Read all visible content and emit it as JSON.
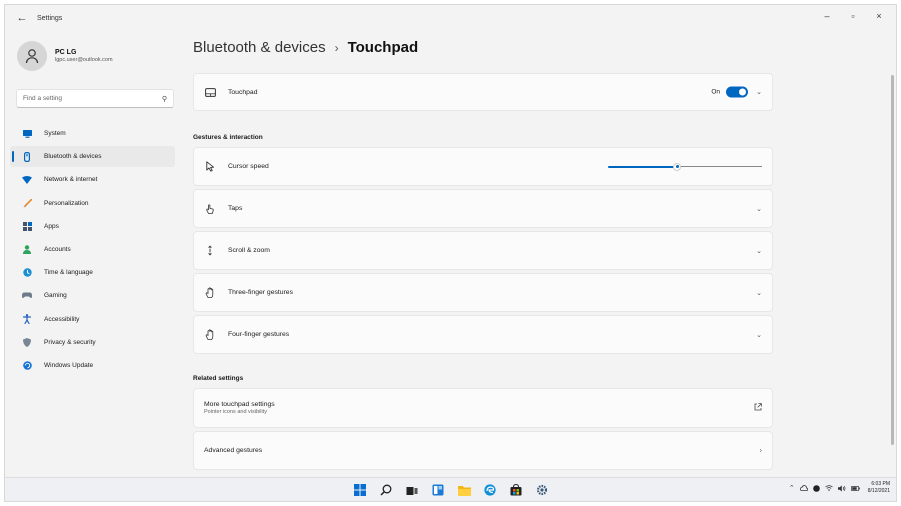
{
  "window": {
    "app_title": "Settings",
    "back_glyph": "←",
    "controls": {
      "minimize": "–",
      "maximize": "▫",
      "close": "×"
    }
  },
  "profile": {
    "name": "PC LG",
    "email": "lgpc.user@outlook.com"
  },
  "search": {
    "placeholder": "Find a setting",
    "icon": "search-icon"
  },
  "sidebar": {
    "items": [
      {
        "label": "System",
        "icon": "system-icon",
        "color": "#0067c0",
        "active": false
      },
      {
        "label": "Bluetooth & devices",
        "icon": "bluetooth-icon",
        "color": "#0067c0",
        "active": true
      },
      {
        "label": "Network & internet",
        "icon": "network-icon",
        "color": "#0067c0",
        "active": false
      },
      {
        "label": "Personalization",
        "icon": "personalization-icon",
        "color": "#e58a2e",
        "active": false
      },
      {
        "label": "Apps",
        "icon": "apps-icon",
        "color": "#44546a",
        "active": false
      },
      {
        "label": "Accounts",
        "icon": "accounts-icon",
        "color": "#2fa35c",
        "active": false
      },
      {
        "label": "Time & language",
        "icon": "time-language-icon",
        "color": "#1b8fd1",
        "active": false
      },
      {
        "label": "Gaming",
        "icon": "gaming-icon",
        "color": "#6c7a89",
        "active": false
      },
      {
        "label": "Accessibility",
        "icon": "accessibility-icon",
        "color": "#1f5fbf",
        "active": false
      },
      {
        "label": "Privacy & security",
        "icon": "shield-icon",
        "color": "#7a8694",
        "active": false
      },
      {
        "label": "Windows Update",
        "icon": "windows-update-icon",
        "color": "#1473d4",
        "active": false
      }
    ]
  },
  "breadcrumb": {
    "parent": "Bluetooth & devices",
    "separator": "›",
    "current": "Touchpad"
  },
  "touchpad": {
    "label": "Touchpad",
    "toggle_text": "On",
    "toggle_on": true,
    "icon": "touchpad-icon"
  },
  "sections": {
    "gestures_title": "Gestures & interaction",
    "related_title": "Related settings"
  },
  "gestures": {
    "cursor_speed": {
      "label": "Cursor speed",
      "icon": "cursor-icon",
      "slider_fraction": 0.45
    },
    "items": [
      {
        "label": "Taps",
        "icon": "tap-icon"
      },
      {
        "label": "Scroll & zoom",
        "icon": "scroll-icon"
      },
      {
        "label": "Three-finger gestures",
        "icon": "hand-icon"
      },
      {
        "label": "Four-finger gestures",
        "icon": "hand-icon"
      }
    ]
  },
  "related": {
    "more": {
      "label": "More touchpad settings",
      "sub": "Pointer icons and visibility",
      "icon": "open-external-icon"
    },
    "advanced": {
      "label": "Advanced gestures",
      "icon": "chevron-right-icon"
    }
  },
  "taskbar": {
    "icons": [
      "start-icon",
      "search-icon",
      "task-view-icon",
      "widgets-icon",
      "file-explorer-icon",
      "edge-icon",
      "store-icon",
      "settings-gear-icon"
    ],
    "tray": [
      "chevron-up-icon",
      "cloud-icon",
      "circle-icon",
      "wifi-icon",
      "speaker-icon",
      "battery-icon"
    ],
    "time": "6:03 PM",
    "date": "8/12/2021"
  },
  "colors": {
    "accent": "#0067c0"
  }
}
